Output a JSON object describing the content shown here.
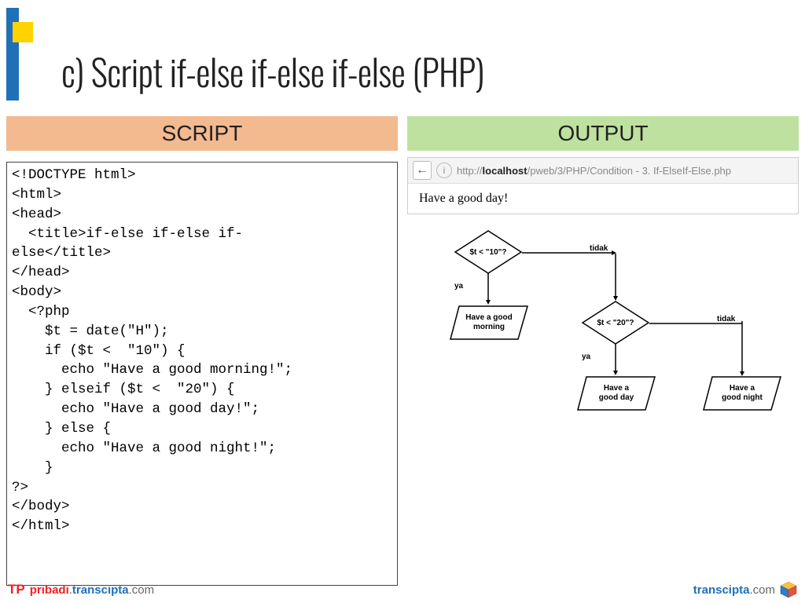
{
  "title": "c) Script if-else if-else if-else (PHP)",
  "headers": {
    "script": "SCRIPT",
    "output": "OUTPUT"
  },
  "code": "<!DOCTYPE html>\n<html>\n<head>\n  <title>if-else if-else if-\nelse</title>\n</head>\n<body>\n  <?php\n    $t = date(\"H\");\n    if ($t <  \"10\") {\n      echo \"Have a good morning!\";\n    } elseif ($t <  \"20\") {\n      echo \"Have a good day!\";\n    } else {\n      echo \"Have a good night!\";\n    }\n?>\n</body>\n</html>",
  "browser": {
    "url_host": "localhost",
    "url_path": "/pweb/3/PHP/Condition - 3. If-ElseIf-Else.php",
    "page_text": "Have a good day!"
  },
  "flow": {
    "d1": "$t < \"10\"?",
    "d2": "$t < \"20\"?",
    "p1": "Have a good\nmorning",
    "p2": "Have a\ngood day",
    "p3": "Have a\ngood night",
    "yes": "ya",
    "no": "tidak"
  },
  "footer": {
    "tp": "TP",
    "l1": "pribadi",
    "dot": ".",
    "l2": "transcipta",
    "l3": ".com",
    "r1": "transcipta",
    "r2": ".com"
  }
}
